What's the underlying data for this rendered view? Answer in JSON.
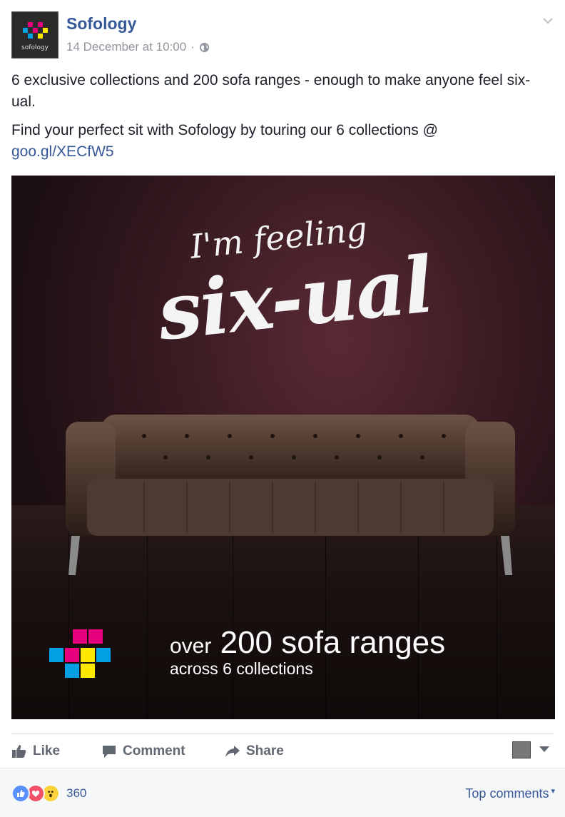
{
  "post": {
    "page_name": "Sofology",
    "timestamp": "14 December at 10:00",
    "separator": "·",
    "avatar_brand": "sofology",
    "message_line1": "6 exclusive collections and 200 sofa ranges - enough to make anyone feel six-ual.",
    "message_line2": "Find your perfect sit with Sofology by touring our 6 collections @",
    "link_text": "goo.gl/XECfW5"
  },
  "image": {
    "headline_small": "I'm feeling",
    "headline_big": "six-ual",
    "tagline_prefix": "over",
    "tagline_main": "200 sofa ranges",
    "tagline_sub": "across 6 collections",
    "logo_colors": [
      "#e6007e",
      "#00a0e3",
      "#ffe800"
    ]
  },
  "actions": {
    "like": "Like",
    "comment": "Comment",
    "share": "Share"
  },
  "footer": {
    "reaction_icons": [
      "like-icon",
      "love-icon",
      "wow-icon"
    ],
    "reaction_count": "360",
    "top_comments": "Top comments",
    "top_comments_caret": "▾"
  },
  "colors": {
    "link": "#365899",
    "meta": "#90949c",
    "action": "#616770"
  }
}
